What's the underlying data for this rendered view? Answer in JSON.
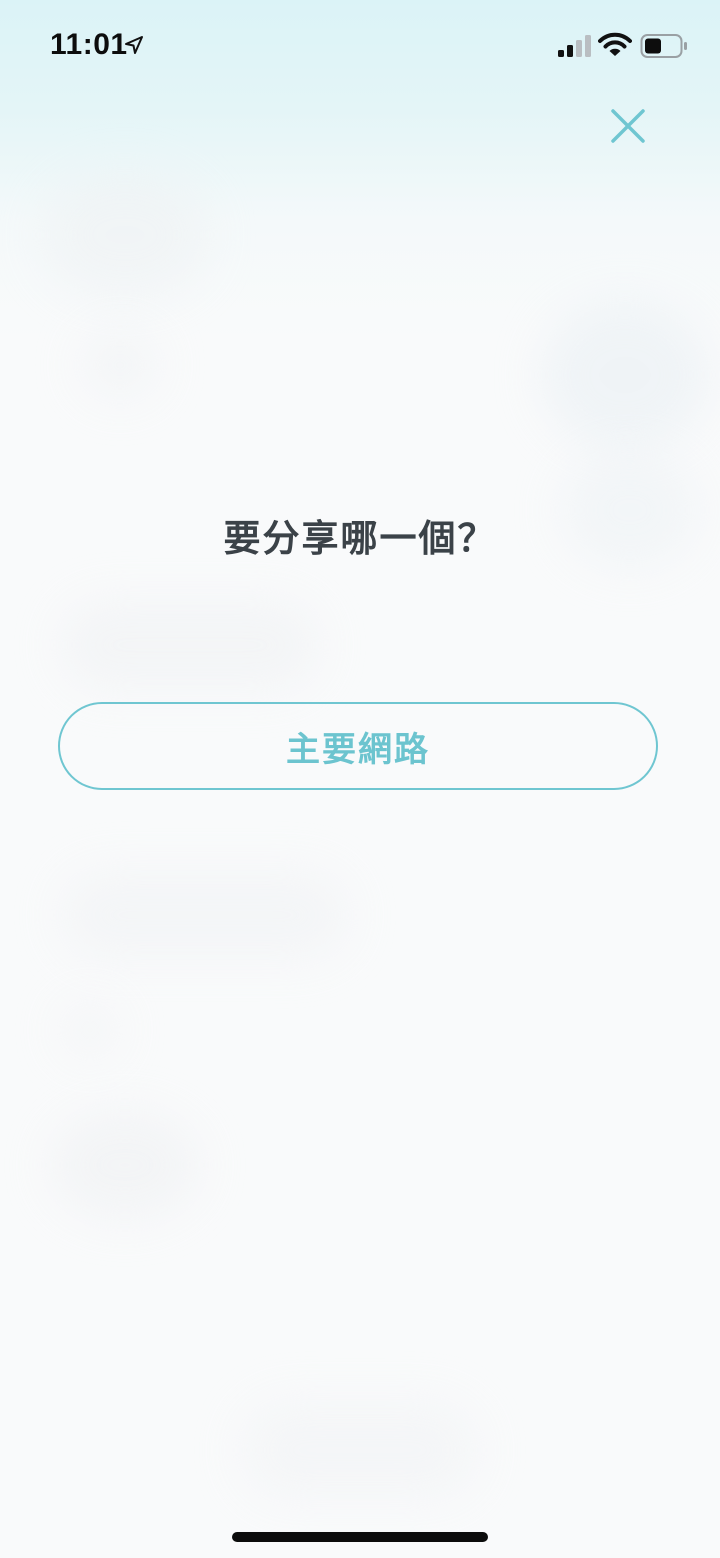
{
  "status_bar": {
    "time": "11:01",
    "icons": [
      "location-arrow-icon",
      "cellular-signal-icon",
      "wifi-icon",
      "battery-icon"
    ]
  },
  "close_icon": "close-icon",
  "prompt": {
    "title": "要分享哪一個？"
  },
  "choices": [
    {
      "label": "主要網路"
    }
  ],
  "colors": {
    "accent": "#6fc6d1",
    "title_text": "#3b4248",
    "top_tint": "#dbf3f7",
    "background": "#f9fafb"
  }
}
